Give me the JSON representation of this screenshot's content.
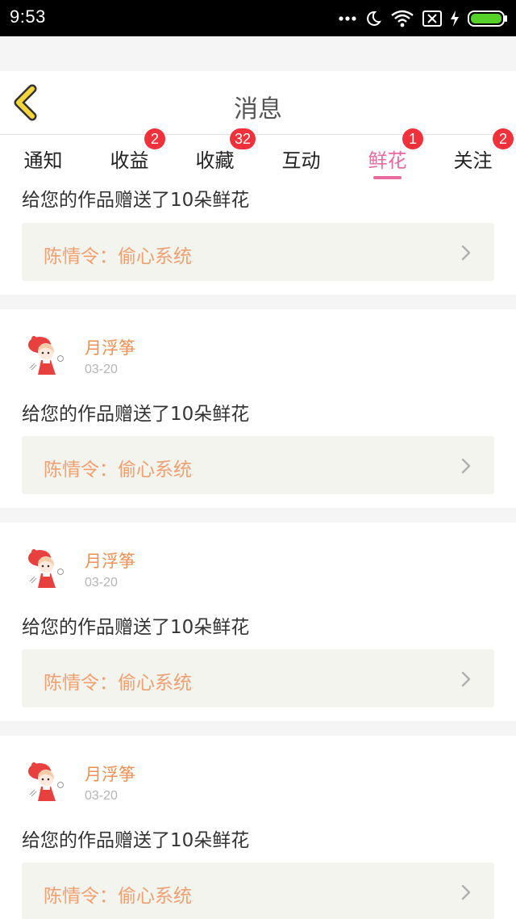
{
  "status_bar": {
    "time": "9:53",
    "icons": [
      "dots-icon",
      "moon-icon",
      "wifi-icon",
      "no-sim-icon",
      "charging-icon",
      "battery-icon"
    ]
  },
  "header": {
    "title": "消息",
    "back_icon": "back-chevron-icon"
  },
  "tabs": [
    {
      "label": "通知",
      "badge": ""
    },
    {
      "label": "收益",
      "badge": "2"
    },
    {
      "label": "收藏",
      "badge": "32"
    },
    {
      "label": "互动",
      "badge": ""
    },
    {
      "label": "鲜花",
      "badge": "1",
      "active": true
    },
    {
      "label": "关注",
      "badge": "2"
    }
  ],
  "feed": {
    "items": [
      {
        "user": "",
        "date": "",
        "message": "给您的作品赠送了10朵鲜花",
        "work": "陈情令：偷心系统"
      },
      {
        "user": "月浮筝",
        "date": "03-20",
        "message": "给您的作品赠送了10朵鲜花",
        "work": "陈情令：偷心系统"
      },
      {
        "user": "月浮筝",
        "date": "03-20",
        "message": "给您的作品赠送了10朵鲜花",
        "work": "陈情令：偷心系统"
      },
      {
        "user": "月浮筝",
        "date": "03-20",
        "message": "给您的作品赠送了10朵鲜花",
        "work": "陈情令：偷心系统"
      }
    ]
  },
  "colors": {
    "accent": "#e86aa0",
    "badge": "#f0303a",
    "username": "#f09050",
    "work_title": "#f0a070",
    "back_icon": "#f5d63a"
  }
}
